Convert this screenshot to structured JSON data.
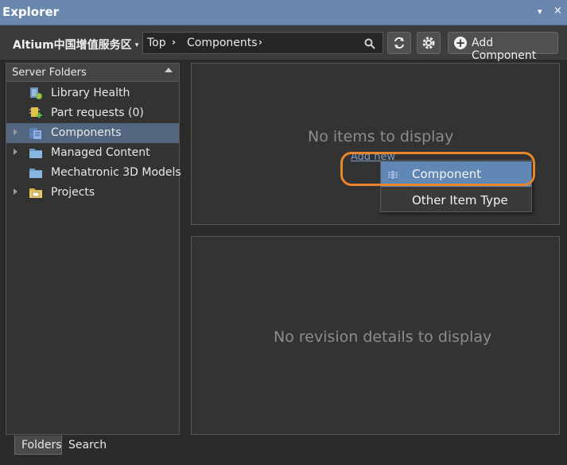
{
  "window": {
    "title": "Explorer",
    "menu_glyph": "▾",
    "close_glyph": "×"
  },
  "toolbar": {
    "server": "Altium中国增值服务区",
    "server_caret": "▾",
    "breadcrumb": [
      "Top",
      "Components"
    ],
    "chevron": "›",
    "add_component_label": "Add Component"
  },
  "left_panel": {
    "header": "Server Folders",
    "items": [
      {
        "label": "Library Health",
        "icon": "library-health-icon",
        "expandable": false
      },
      {
        "label": "Part requests (0)",
        "icon": "part-requests-icon",
        "expandable": false
      },
      {
        "label": "Components",
        "icon": "components-folder-icon",
        "expandable": true,
        "selected": true
      },
      {
        "label": "Managed Content",
        "icon": "folder-icon",
        "expandable": true
      },
      {
        "label": "Mechatronic 3D Models",
        "icon": "folder-icon",
        "expandable": false
      },
      {
        "label": "Projects",
        "icon": "projects-folder-icon",
        "expandable": true
      }
    ]
  },
  "items_panel": {
    "empty_message": "No items to display",
    "add_new_link": "Add new"
  },
  "context_menu": {
    "items": [
      {
        "label": "Component",
        "highlighted": true
      },
      {
        "label": "Other Item Type",
        "highlighted": false
      }
    ]
  },
  "details_panel": {
    "empty_message": "No revision details to display"
  },
  "tabs": [
    {
      "label": "Folders",
      "active": true
    },
    {
      "label": "Search",
      "active": false
    }
  ],
  "colors": {
    "accent": "#6a88ad",
    "selection": "#52677f",
    "menu_highlight": "#6188b4",
    "annotation_ring": "#e9852a"
  }
}
